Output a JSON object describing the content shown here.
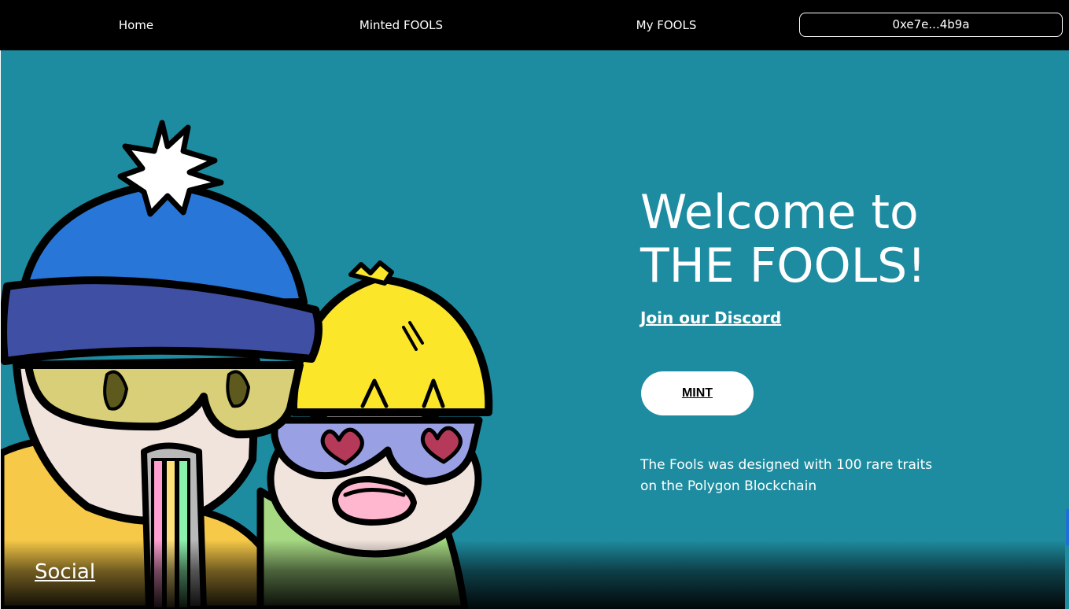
{
  "nav": {
    "items": [
      {
        "label": "Home"
      },
      {
        "label": "Minted FOOLS"
      },
      {
        "label": "My FOOLS"
      }
    ],
    "wallet_address": "0xe7e...4b9a"
  },
  "hero": {
    "title_line1": "Welcome to",
    "title_line2": "THE FOOLS!",
    "discord_link": "Join our Discord",
    "mint_button": "MINT",
    "description": "The Fools was designed with 100 rare traits on the Polygon Blockchain",
    "social_link": "Social",
    "illustration": "two-fools-characters-illustration"
  },
  "colors": {
    "nav_background": "#000000",
    "hero_background": "#1e8ca0",
    "text": "#ffffff",
    "mint_button_background": "#ffffff",
    "scrollbar_accent": "#1e6fd8"
  }
}
